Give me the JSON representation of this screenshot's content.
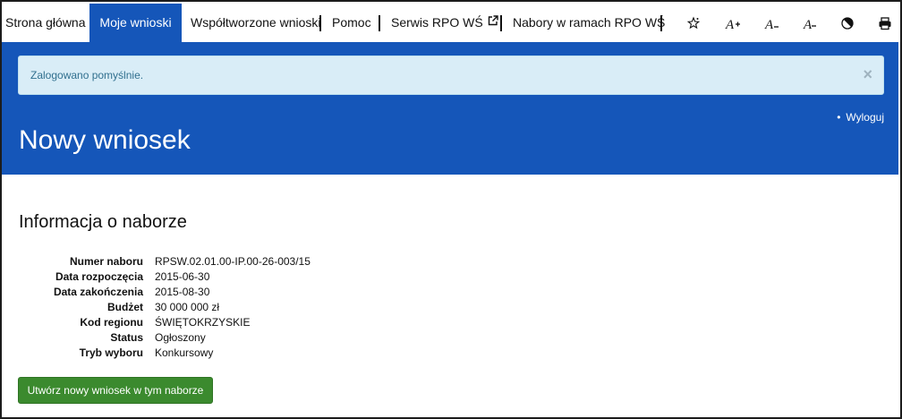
{
  "nav": {
    "items": [
      {
        "label": "Strona główna"
      },
      {
        "label": "Moje wnioski",
        "active": true
      },
      {
        "label": "Współtworzone wnioski"
      },
      {
        "label": "Pomoc"
      },
      {
        "label": "Serwis RPO WŚ",
        "external": true
      },
      {
        "label": "Nabory w ramach RPO WŚ"
      }
    ],
    "tools": [
      {
        "icon": "contrast-star-icon"
      },
      {
        "icon": "font-increase-icon"
      },
      {
        "icon": "font-normal-icon"
      },
      {
        "icon": "font-decrease-icon"
      },
      {
        "icon": "contrast-icon"
      },
      {
        "icon": "print-icon"
      }
    ],
    "accent_color": "#1556b9"
  },
  "alert": {
    "text": "Zalogowano pomyślnie.",
    "close": "×"
  },
  "header": {
    "logout": "Wyloguj",
    "title": "Nowy wniosek"
  },
  "info": {
    "title": "Informacja o naborze",
    "rows": [
      {
        "label": "Numer naboru",
        "value": "RPSW.02.01.00-IP.00-26-003/15"
      },
      {
        "label": "Data rozpoczęcia",
        "value": "2015-06-30"
      },
      {
        "label": "Data zakończenia",
        "value": "2015-08-30"
      },
      {
        "label": "Budżet",
        "value": "30 000 000 zł"
      },
      {
        "label": "Kod regionu",
        "value": "ŚWIĘTOKRZYSKIE"
      },
      {
        "label": "Status",
        "value": "Ogłoszony"
      },
      {
        "label": "Tryb wyboru",
        "value": "Konkursowy"
      }
    ]
  },
  "action": {
    "create_label": "Utwórz nowy wniosek w tym naborze",
    "color": "#3b8a2e"
  }
}
